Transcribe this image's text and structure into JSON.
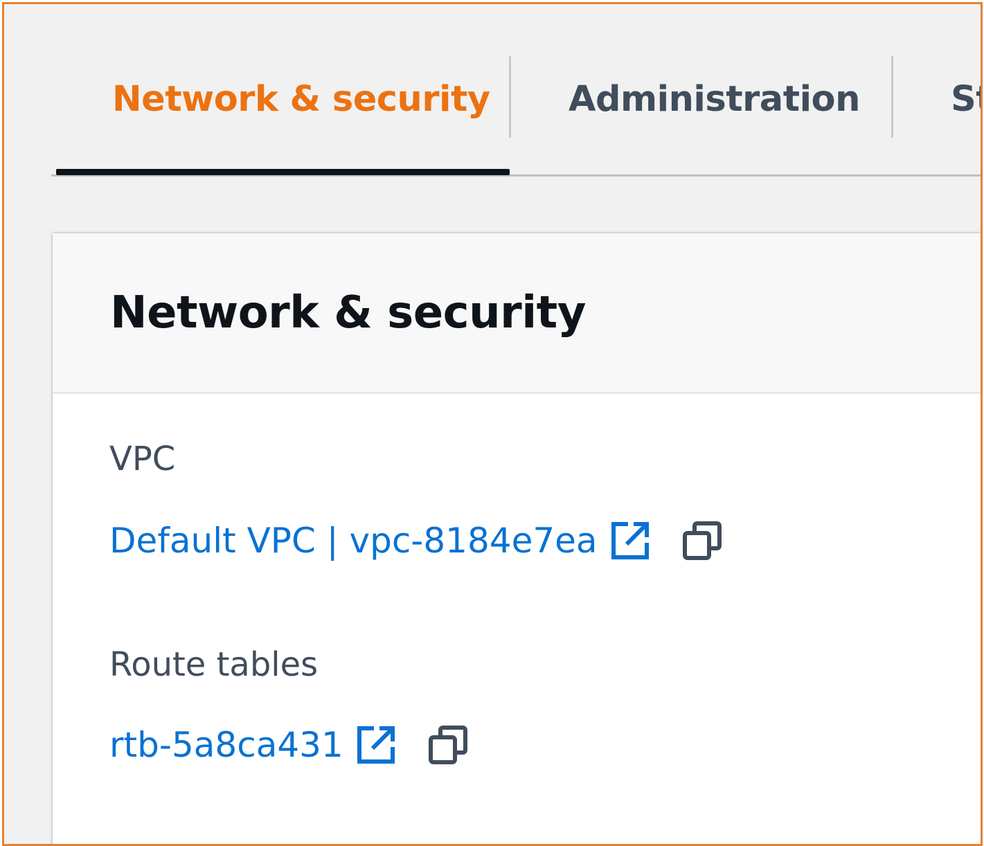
{
  "colors": {
    "accent": "#ec7211",
    "link": "#0972d3",
    "frame_border": "#e8812f",
    "text_dark": "#0f141a",
    "text_muted": "#414d5c"
  },
  "tabs": [
    {
      "label": "Network & security",
      "active": true
    },
    {
      "label": "Administration",
      "active": false
    },
    {
      "label": "St",
      "active": false
    }
  ],
  "panel": {
    "title": "Network & security",
    "fields": [
      {
        "label": "VPC",
        "value": "Default VPC | vpc-8184e7ea",
        "icons": [
          "external-link-icon",
          "copy-icon"
        ]
      },
      {
        "label": "Route tables",
        "value": "rtb-5a8ca431",
        "icons": [
          "external-link-icon",
          "copy-icon"
        ]
      }
    ]
  }
}
